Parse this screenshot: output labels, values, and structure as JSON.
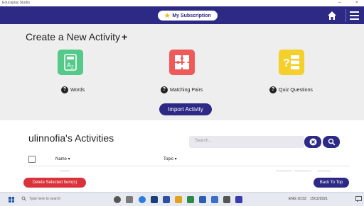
{
  "window": {
    "title": "Educaplay Studio",
    "min": "–",
    "close": "×"
  },
  "header": {
    "subscription_label": "My Subscription"
  },
  "create": {
    "title": "Create a New Activity",
    "plus": "+",
    "activities": [
      {
        "label": "Words",
        "icon": "words-az-icon",
        "color": "#54c98a"
      },
      {
        "label": "Matching Pairs",
        "icon": "puzzle-icon",
        "color": "#ee5a5a"
      },
      {
        "label": "Quiz Questions",
        "icon": "quiz-icon",
        "color": "#f5cf2a"
      }
    ],
    "import_label": "Import Activity"
  },
  "activities_section": {
    "title": "ulinnofia's Activities",
    "search_placeholder": "Search...",
    "columns": {
      "name": "Name ▾",
      "topic": "Topic ▾"
    },
    "delete_label": "Delete Selected Item(s)",
    "back_to_top_label": "Back To Top"
  },
  "taskbar": {
    "search_placeholder": "Type here to search",
    "tray_text": "ENG  10:32",
    "date_text": "15/11/2021"
  },
  "colors": {
    "brand": "#2d2a86",
    "danger": "#d9323a",
    "panel": "#eeeeee"
  }
}
